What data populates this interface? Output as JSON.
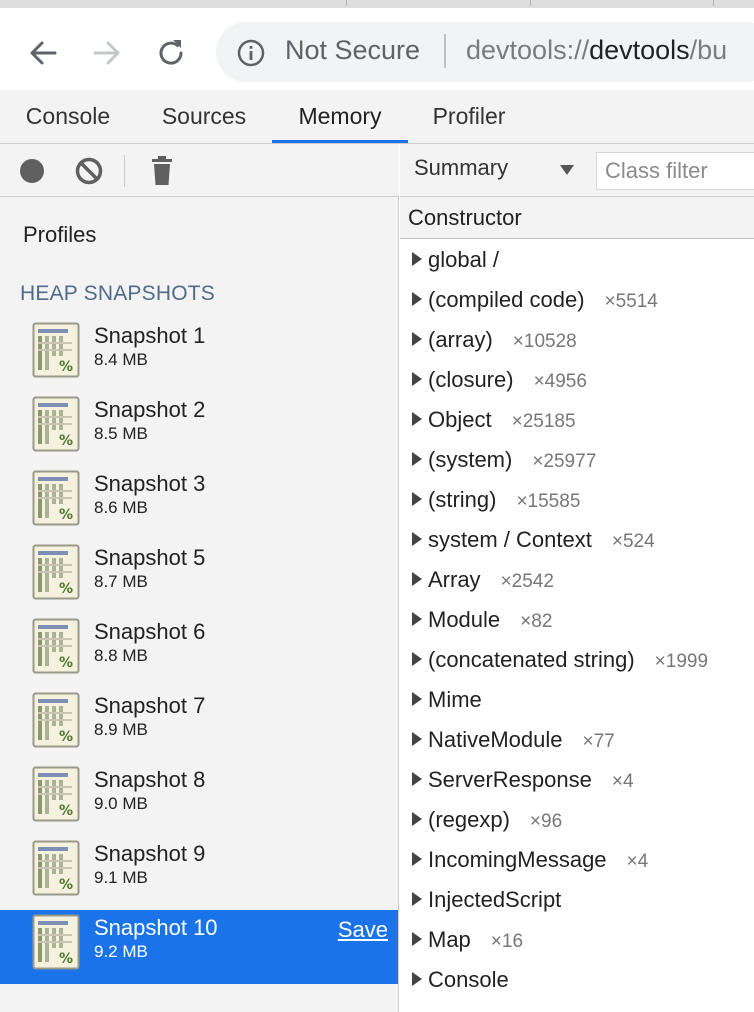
{
  "browser": {
    "security_label": "Not Secure",
    "url_scheme": "devtools://",
    "url_host": "devtools",
    "url_rest": "/bu"
  },
  "tabs": [
    {
      "label": "Console"
    },
    {
      "label": "Sources"
    },
    {
      "label": "Memory"
    },
    {
      "label": "Profiler"
    }
  ],
  "active_tab": "Memory",
  "sidebar": {
    "profiles_label": "Profiles",
    "section_label": "HEAP SNAPSHOTS",
    "snapshots": [
      {
        "name": "Snapshot 1",
        "size": "8.4 MB"
      },
      {
        "name": "Snapshot 2",
        "size": "8.5 MB"
      },
      {
        "name": "Snapshot 3",
        "size": "8.6 MB"
      },
      {
        "name": "Snapshot 5",
        "size": "8.7 MB"
      },
      {
        "name": "Snapshot 6",
        "size": "8.8 MB"
      },
      {
        "name": "Snapshot 7",
        "size": "8.9 MB"
      },
      {
        "name": "Snapshot 8",
        "size": "9.0 MB"
      },
      {
        "name": "Snapshot 9",
        "size": "9.1 MB"
      },
      {
        "name": "Snapshot 10",
        "size": "9.2 MB",
        "selected": true,
        "save_label": "Save"
      }
    ]
  },
  "view": {
    "mode": "Summary",
    "class_filter_placeholder": "Class filter",
    "column_header": "Constructor",
    "rows": [
      {
        "name": "global /",
        "count": ""
      },
      {
        "name": "(compiled code)",
        "count": "×5514"
      },
      {
        "name": "(array)",
        "count": "×10528"
      },
      {
        "name": "(closure)",
        "count": "×4956"
      },
      {
        "name": "Object",
        "count": "×25185"
      },
      {
        "name": "(system)",
        "count": "×25977"
      },
      {
        "name": "(string)",
        "count": "×15585"
      },
      {
        "name": "system / Context",
        "count": "×524"
      },
      {
        "name": "Array",
        "count": "×2542"
      },
      {
        "name": "Module",
        "count": "×82"
      },
      {
        "name": "(concatenated string)",
        "count": "×1999"
      },
      {
        "name": "Mime",
        "count": ""
      },
      {
        "name": "NativeModule",
        "count": "×77"
      },
      {
        "name": "ServerResponse",
        "count": "×4"
      },
      {
        "name": "(regexp)",
        "count": "×96"
      },
      {
        "name": "IncomingMessage",
        "count": "×4"
      },
      {
        "name": "InjectedScript",
        "count": ""
      },
      {
        "name": "Map",
        "count": "×16"
      },
      {
        "name": "Console",
        "count": ""
      }
    ]
  },
  "colors": {
    "accent": "#1a73e8",
    "panel_bg": "#f3f3f3",
    "section_label": "#4f6b8c"
  }
}
